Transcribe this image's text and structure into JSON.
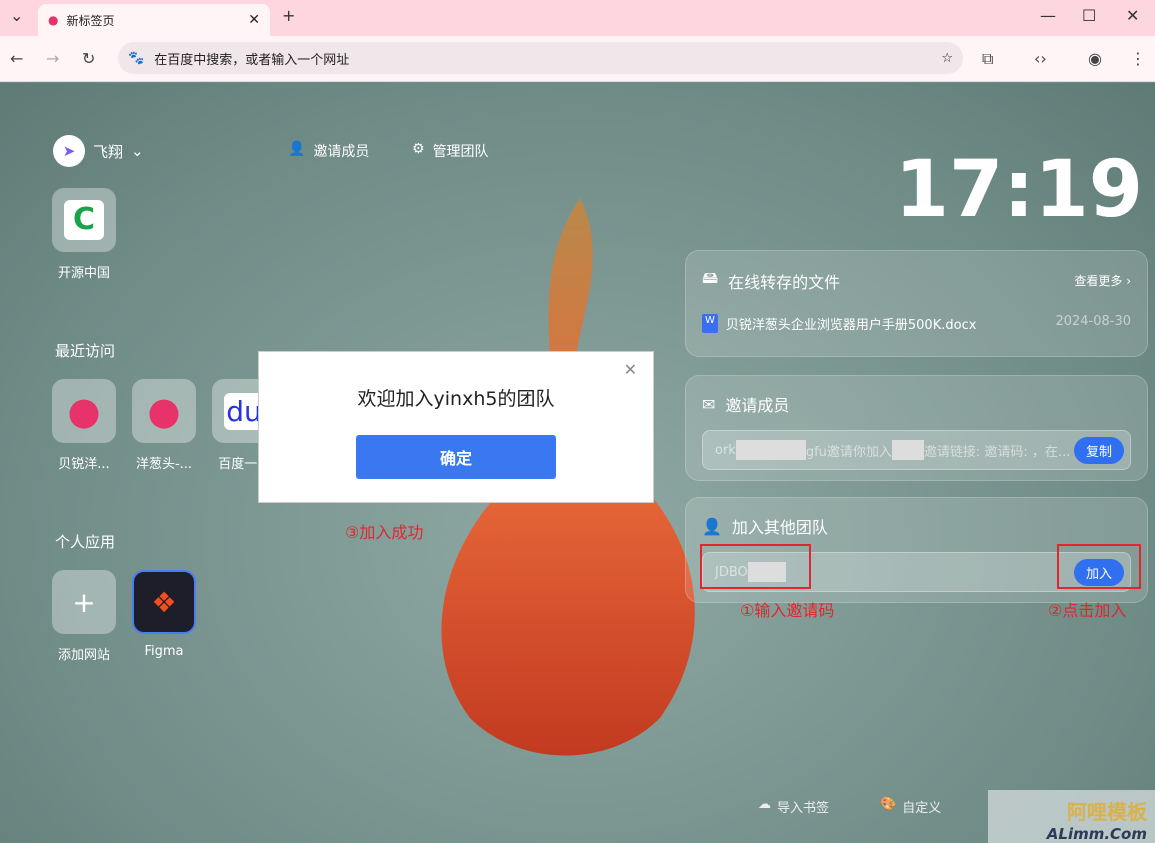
{
  "browser": {
    "tab_title": "新标签页",
    "address_placeholder": "在百度中搜索，或者输入一个网址"
  },
  "header": {
    "user": "飞翔",
    "invite": "邀请成员",
    "manage": "管理团队",
    "clock": "17:19"
  },
  "pinned": [
    {
      "label": "开源中国"
    }
  ],
  "recent": {
    "title": "最近访问",
    "items": [
      {
        "label": "贝锐洋..."
      },
      {
        "label": "洋葱头-..."
      },
      {
        "label": "百度一..."
      }
    ]
  },
  "personal": {
    "title": "个人应用",
    "items": [
      {
        "label": "添加网站"
      },
      {
        "label": "Figma"
      }
    ]
  },
  "files": {
    "title": "在线转存的文件",
    "more": "查看更多",
    "items": [
      {
        "name": "贝锐洋葱头企业浏览器用户手册500K.docx",
        "date": "2024-08-30"
      }
    ]
  },
  "invite": {
    "title": "邀请成员",
    "text_a": "ork",
    "text_b": "gfu邀请你加入",
    "text_c": "邀请链接: 邀请码: ，在...",
    "copy": "复制"
  },
  "join": {
    "title": "加入其他团队",
    "value": "JDBO",
    "button": "加入"
  },
  "dialog": {
    "message": "欢迎加入yinxh5的团队",
    "ok": "确定"
  },
  "annotations": {
    "step1": "①输入邀请码",
    "step2": "②点击加入",
    "step3": "③加入成功"
  },
  "footer": {
    "import": "导入书签",
    "customize": "自定义"
  },
  "watermark": {
    "cn": "阿哩模板",
    "en": "ALimm.Com"
  },
  "colors": {
    "accent": "#3a78f2",
    "annotation": "#e0262e"
  }
}
